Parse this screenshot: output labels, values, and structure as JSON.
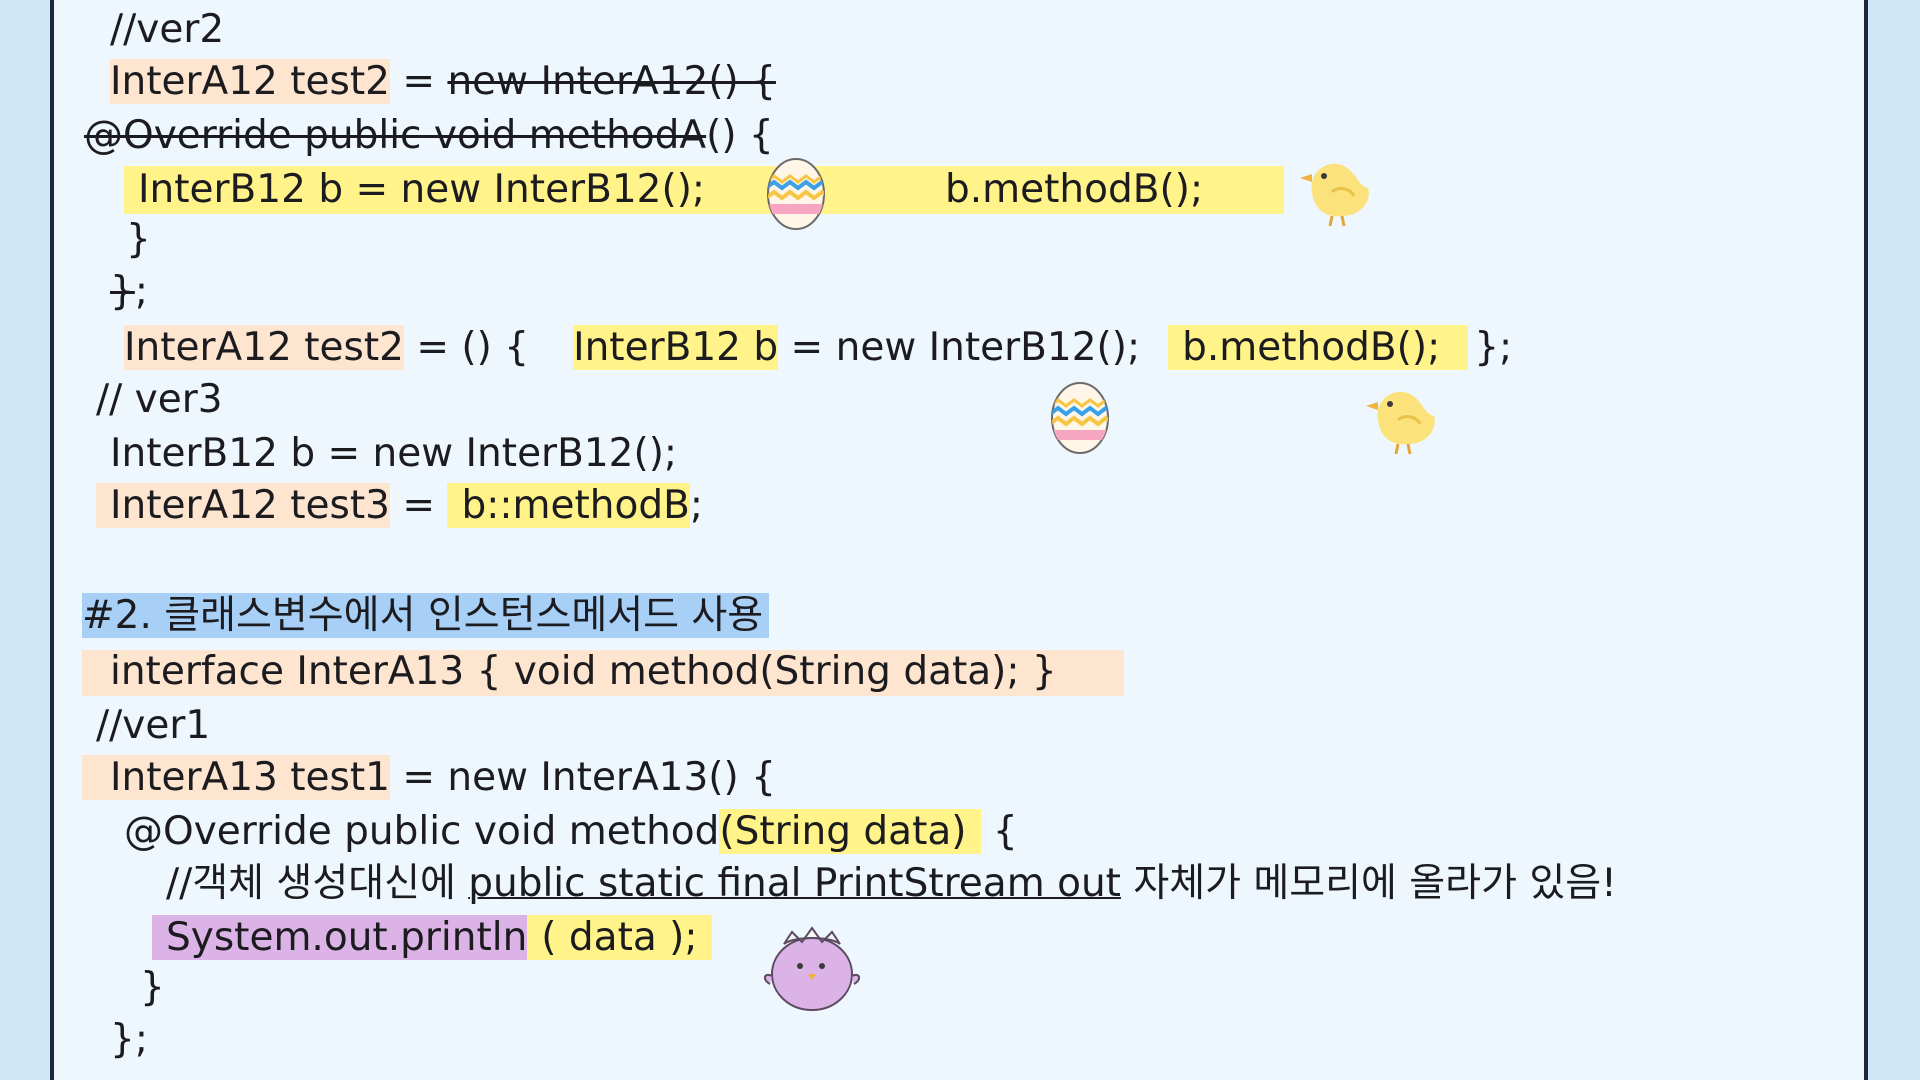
{
  "code": {
    "l1": "//ver2",
    "l2a": "InterA12 test2",
    "l2b": " = ",
    "l2c": "new InterA12() {",
    "l3a": "@Override public void methodA",
    "l3b": "() {",
    "l4a": "InterB12 b = new InterB12();",
    "l4b": "b.methodB();",
    "l5": "}",
    "l6a": "}",
    "l6b": ";",
    "l7a": "InterA12 test2",
    "l7b": " =  () {",
    "l7c": "InterB12 b",
    "l7d": " = new InterB12();",
    "l7e": "b.methodB();",
    "l7f": "};",
    "l8": "// ver3",
    "l9": "InterB12 b = new InterB12();",
    "l10a": "InterA12 test3",
    "l10b": " = ",
    "l10c": "b::methodB",
    "l10d": ";",
    "h2": "#2. 클래스변수에서 인스턴스메서드 사용",
    "l12": "interface InterA13 { void method(String data); }",
    "l13": "//ver1",
    "l14a": "InterA13 test1",
    "l14b": " = new InterA13() {",
    "l15a": "@Override public void method",
    "l15b": "(String data)",
    "l15c": " {",
    "l16a": "//객체 생성대신에 ",
    "l16b": "public static final PrintStream out",
    "l16c": " 자체가 메모리에 올라가 있음!",
    "l17a": "System.out.println",
    "l17b": "( data );",
    "l18": "}",
    "l19": "};"
  },
  "colors": {
    "peach": "#fde5cf",
    "yellow": "#fff38a",
    "blue": "#a8d0f6",
    "lavender": "#dcb3e6"
  },
  "stickers": [
    "easter-egg-icon",
    "chick-icon",
    "hatching-chick-icon"
  ]
}
